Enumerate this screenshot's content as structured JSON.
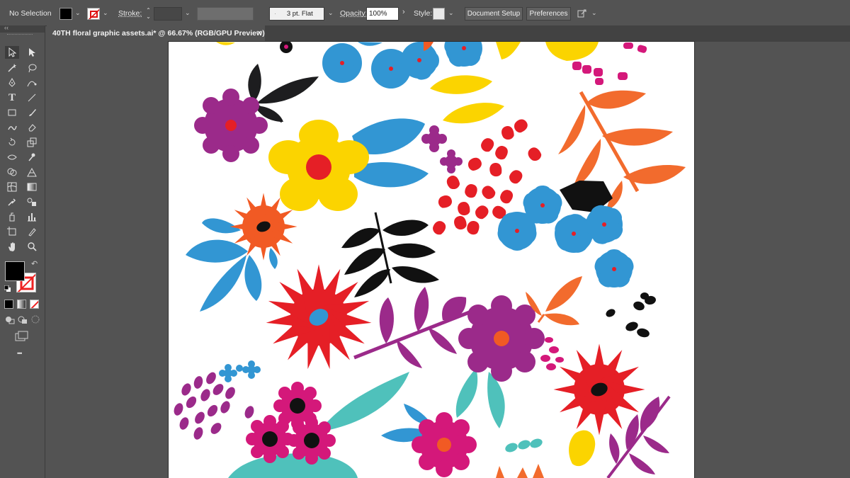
{
  "control_bar": {
    "selection_label": "No Selection",
    "stroke_label": "Stroke:",
    "stroke_profile": "3 pt. Flat",
    "opacity_label": "Opacity:",
    "opacity_value": "100%",
    "style_label": "Style:",
    "document_setup_button": "Document Setup",
    "preferences_button": "Preferences"
  },
  "document_tab": {
    "title": "40TH floral graphic assets.ai* @ 66.67% (RGB/GPU Preview)",
    "close": "✕"
  },
  "toolbar": {
    "collapse": "‹‹",
    "more": "•••",
    "type_tool": "T",
    "fill_color": "#000000",
    "stroke_color": "none"
  },
  "colors": {
    "ui_bg": "#535353",
    "blue": "#3296d3",
    "yellow": "#fbd400",
    "red": "#e51f26",
    "orange": "#f15a24",
    "orange_light": "#f26b2d",
    "purple": "#9b2a8a",
    "magenta": "#d4187a",
    "teal": "#4fc1bb",
    "black": "#111111"
  }
}
